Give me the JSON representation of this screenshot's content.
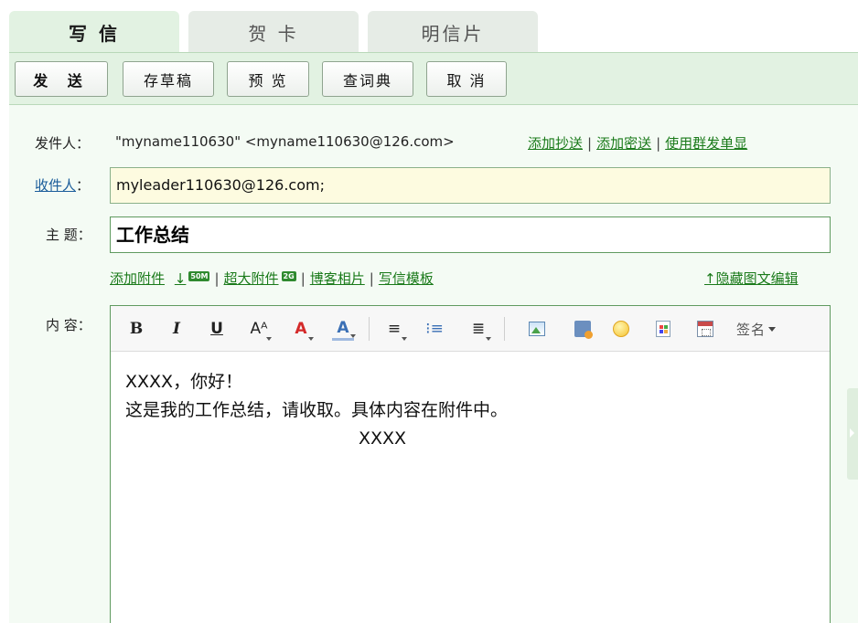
{
  "tabs": [
    {
      "label": "写 信",
      "active": true
    },
    {
      "label": "贺 卡",
      "active": false
    },
    {
      "label": "明信片",
      "active": false
    }
  ],
  "toolbar": {
    "send": "发 送",
    "draft": "存草稿",
    "preview": "预 览",
    "dictionary": "查词典",
    "cancel": "取 消"
  },
  "form": {
    "from_label": "发件人：",
    "from_value": "\"myname110630\" <myname110630@126.com>",
    "add_cc": "添加抄送",
    "add_bcc": "添加密送",
    "group_send": "使用群发单显",
    "to_label": "收件人",
    "to_colon": "：",
    "to_value": "myleader110630@126.com;",
    "subject_label": "主 题：",
    "subject_value": "工作总结",
    "add_attachment": "添加附件",
    "attach_arrow": "↓",
    "attach_badge": "50M",
    "big_attachment": "超大附件",
    "big_badge": "2G",
    "blog_photos": "博客相片",
    "templates": "写信模板",
    "hide_editor": "↑隐藏图文编辑",
    "content_label": "内 容："
  },
  "editor": {
    "bold": "B",
    "italic": "I",
    "underline": "U",
    "font_size": "Aᴬ",
    "font_color": "A",
    "bg_color": "A",
    "align": "≡",
    "list": "⁝≡",
    "indent": "≣",
    "signature": "签名"
  },
  "body": {
    "line1": "XXXX，你好！",
    "line2": "这是我的工作总结，请收取。具体内容在附件中。",
    "line3": "XXXX"
  },
  "colors": {
    "accent_green": "#1a7a1a",
    "tab_active_bg": "#e2f2e2",
    "to_field_bg": "#fdfbe0",
    "font_color_red": "#d42a2a",
    "bg_color_blue": "#3a6fb5"
  },
  "icons": [
    "image-icon",
    "attachment-icon",
    "emoticon-icon",
    "table-icon",
    "calendar-icon"
  ]
}
